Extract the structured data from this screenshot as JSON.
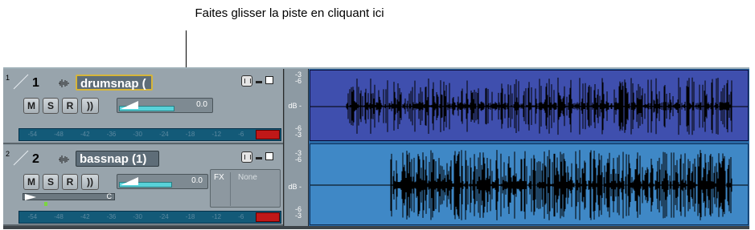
{
  "annotation": {
    "text": "Faites glisser la piste en cliquant ici"
  },
  "tracks": [
    {
      "index_small": "1",
      "number": "1",
      "name": "drumsnap (",
      "buttons": {
        "mute": "M",
        "solo": "S",
        "record": "R",
        "monitor": "))"
      },
      "volume_value": "0.0",
      "volume_fraction": 0.62,
      "meter_ticks": [
        "-54",
        "-48",
        "-42",
        "-36",
        "-30",
        "-24",
        "-18",
        "-12",
        "-6"
      ],
      "selected": true,
      "lane_color": "#3f4fae"
    },
    {
      "index_small": "2",
      "number": "2",
      "name": "bassnap (1)",
      "buttons": {
        "mute": "M",
        "solo": "S",
        "record": "R",
        "monitor": "))"
      },
      "volume_value": "0.0",
      "volume_fraction": 0.62,
      "fx_label": "FX",
      "fx_value": "None",
      "pan_label": "C",
      "meter_ticks": [
        "-54",
        "-48",
        "-42",
        "-36",
        "-30",
        "-24",
        "-18",
        "-12",
        "-6"
      ],
      "selected": false,
      "lane_color": "#3f88c6"
    }
  ],
  "db_scale": {
    "top": [
      "-3",
      "-6"
    ],
    "mid": "dB -",
    "bottom": [
      "-6",
      "-3"
    ]
  },
  "icons": {
    "track_wave": "waveform-icon",
    "envelope": "envelope-icon",
    "minimize": "minimize-icon",
    "maximize": "maximize-icon"
  }
}
